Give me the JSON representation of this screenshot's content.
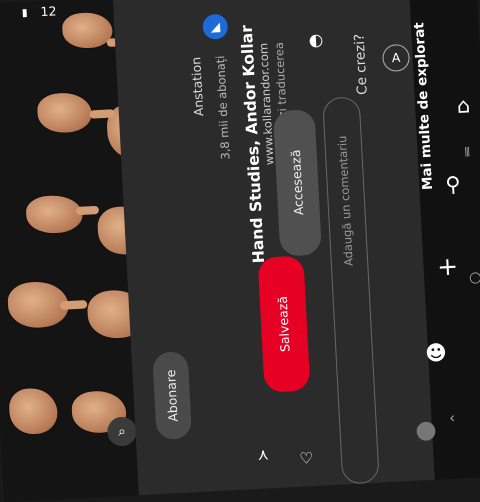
{
  "status": {
    "time": "12",
    "signal_icon": "signal-icon"
  },
  "pin": {
    "title": "Hand Studies, Andor Kollar",
    "url": "www.kollarandor.com",
    "translate_link": "Vezi traducerea",
    "author": "Anstation",
    "followers": "3,8 mii de abonați",
    "visit_label": "Accesează",
    "save_label": "Salvează",
    "follow_label": "Abonare"
  },
  "comments": {
    "question": "Ce crezi?",
    "avatar_letter": "A",
    "placeholder": "Adaugă un comentariu"
  },
  "more": {
    "title": "Mai multe de explorat"
  },
  "colors": {
    "save_button": "#e60023",
    "avatar": "#1c6bd6"
  }
}
